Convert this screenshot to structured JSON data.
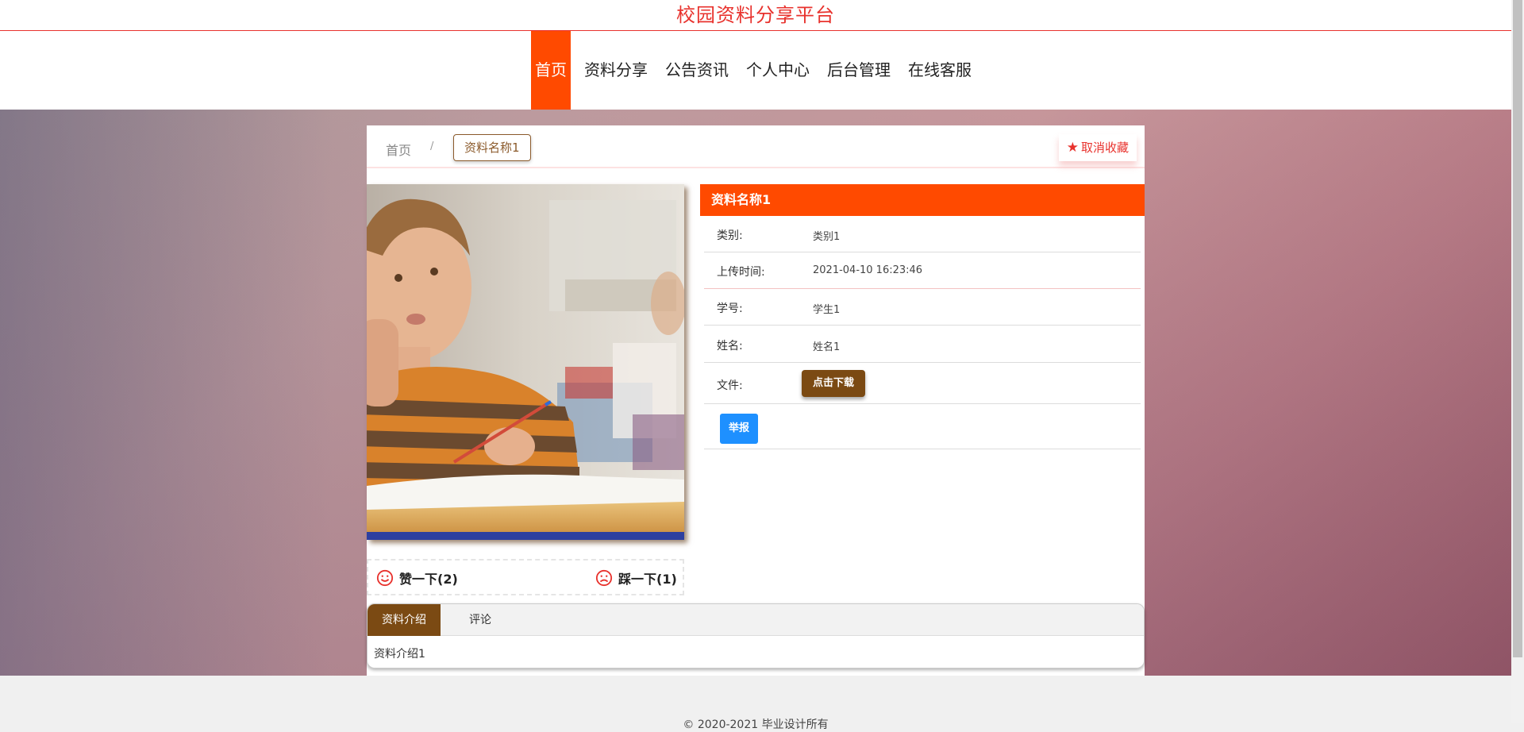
{
  "site": {
    "title": "校园资料分享平台"
  },
  "nav": {
    "items": [
      {
        "label": "首页",
        "active": true
      },
      {
        "label": "资料分享"
      },
      {
        "label": "公告资讯"
      },
      {
        "label": "个人中心"
      },
      {
        "label": "后台管理"
      },
      {
        "label": "在线客服"
      }
    ]
  },
  "breadcrumb": {
    "home": "首页",
    "separator": "/",
    "current": "资料名称1"
  },
  "favorite": {
    "label": "取消收藏",
    "icon": "star-icon"
  },
  "detail": {
    "title": "资料名称1",
    "rows": [
      {
        "label": "类别:",
        "value": "类别1"
      },
      {
        "label": "上传时间:",
        "value": "2021-04-10 16:23:46"
      },
      {
        "label": "学号:",
        "value": "学生1"
      },
      {
        "label": "姓名:",
        "value": "姓名1"
      },
      {
        "label": "文件:"
      }
    ],
    "download_label": "点击下载",
    "report_label": "举报"
  },
  "votes": {
    "like_label": "赞一下(2)",
    "dislike_label": "踩一下(1)"
  },
  "tabs": {
    "items": [
      {
        "label": "资料介绍",
        "active": true
      },
      {
        "label": "评论"
      }
    ],
    "content": "资料介绍1"
  },
  "footer": {
    "text": "© 2020-2021 毕业设计所有"
  },
  "colors": {
    "brand_red": "#e8322d",
    "accent_orange": "#ff4a00",
    "brown": "#7b4a13",
    "report_blue": "#1e90ff"
  }
}
